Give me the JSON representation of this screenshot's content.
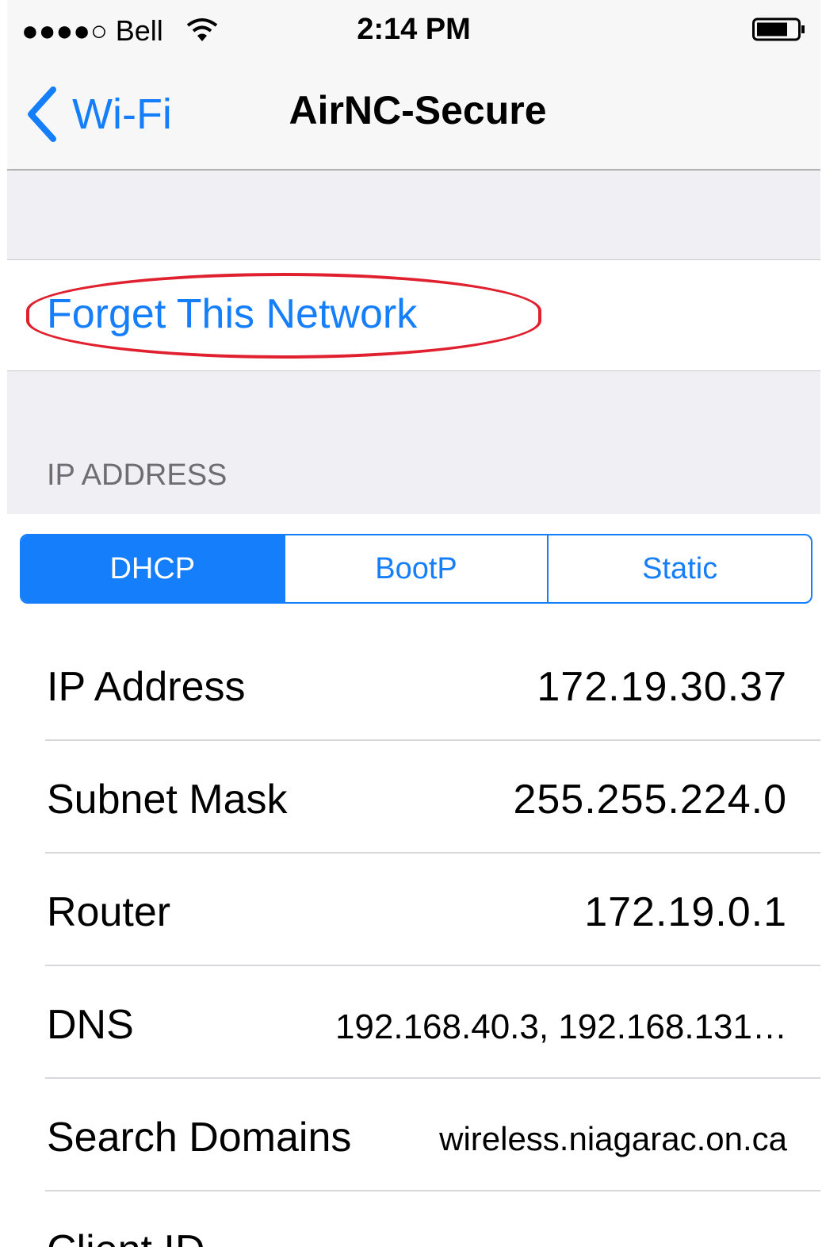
{
  "status_bar": {
    "carrier": "●●●●○ Bell",
    "time": "2:14 PM",
    "icons": [
      "wifi-icon",
      "battery-icon"
    ]
  },
  "nav": {
    "back_label": "Wi-Fi",
    "title": "AirNC-Secure"
  },
  "forget": {
    "label": "Forget This Network"
  },
  "ip_section": {
    "header": "IP ADDRESS",
    "segments": [
      "DHCP",
      "BootP",
      "Static"
    ],
    "selected_segment": "DHCP"
  },
  "rows": [
    {
      "label": "IP Address",
      "value": "172.19.30.37"
    },
    {
      "label": "Subnet Mask",
      "value": "255.255.224.0"
    },
    {
      "label": "Router",
      "value": "172.19.0.1"
    },
    {
      "label": "DNS",
      "value": "192.168.40.3, 192.168.131…"
    },
    {
      "label": "Search Domains",
      "value": "wireless.niagarac.on.ca"
    },
    {
      "label": "Client ID",
      "value": ""
    }
  ],
  "colors": {
    "accent": "#157efb",
    "highlight_circle": "#e0202e",
    "grouped_bg": "#efeff4"
  }
}
